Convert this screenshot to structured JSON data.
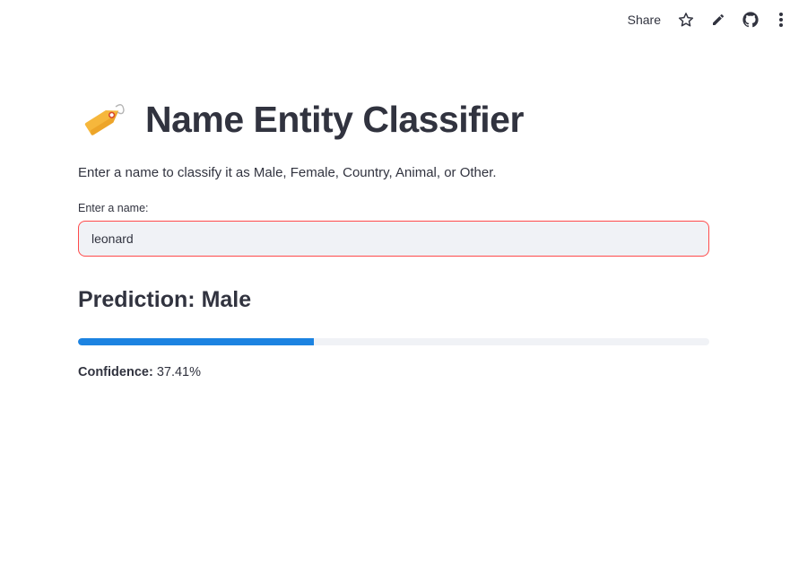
{
  "toolbar": {
    "share_label": "Share",
    "icons": [
      "star-icon",
      "pencil-icon",
      "github-icon",
      "more-vertical-icon"
    ]
  },
  "header": {
    "emoji": "label-tag-icon",
    "title": "Name Entity Classifier"
  },
  "description": "Enter a name to classify it as Male, Female, Country, Animal, or Other.",
  "name_input": {
    "label": "Enter a name:",
    "value": "leonard"
  },
  "result": {
    "prediction_label": "Prediction:",
    "prediction_value": "Male",
    "confidence_label": "Confidence:",
    "confidence_value": "37.41%",
    "confidence_fraction": 0.3741
  },
  "colors": {
    "accent": "#1c83e1",
    "input_border": "#ff4b4b",
    "text": "#31333f",
    "track": "#f0f2f6"
  }
}
